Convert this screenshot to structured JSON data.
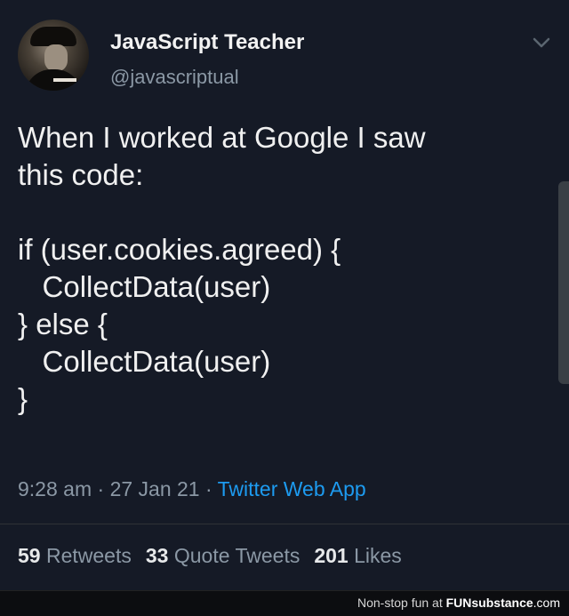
{
  "tweet": {
    "display_name": "JavaScript Teacher",
    "handle": "@javascriptual",
    "text": "When I worked at Google I saw\nthis code:\n\nif (user.cookies.agreed) {\n   CollectData(user)\n} else {\n   CollectData(user)\n}",
    "time": "9:28 am",
    "separator": " · ",
    "date": "27 Jan 21",
    "source": "Twitter Web App",
    "stats": {
      "retweets_count": "59",
      "retweets_label": "Retweets",
      "quotes_count": "33",
      "quotes_label": "Quote Tweets",
      "likes_count": "201",
      "likes_label": "Likes"
    },
    "icons": {
      "more": "chevron-down-icon"
    }
  },
  "footer": {
    "tagline": "Non-stop fun at",
    "brand": "FUNsubstance",
    "tld": ".com"
  },
  "colors": {
    "background": "#151a26",
    "text": "#e7e9ea",
    "muted": "#8b98a5",
    "link": "#1d9bf0"
  }
}
